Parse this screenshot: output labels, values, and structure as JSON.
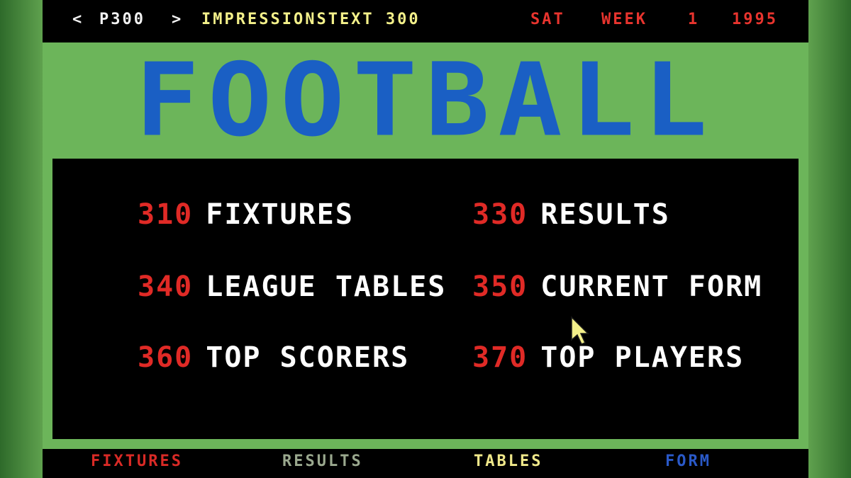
{
  "header": {
    "prev": "<",
    "page": "P300",
    "next": ">",
    "service": "IMPRESSIONSTEXT 300",
    "day": "SAT",
    "week_label": "WEEK",
    "week_number": "1",
    "year": "1995"
  },
  "title": "FOOTBALL",
  "menu": [
    {
      "number": "310",
      "label": "FIXTURES"
    },
    {
      "number": "330",
      "label": "RESULTS"
    },
    {
      "number": "340",
      "label": "LEAGUE TABLES"
    },
    {
      "number": "350",
      "label": "CURRENT FORM"
    },
    {
      "number": "360",
      "label": "TOP SCORERS"
    },
    {
      "number": "370",
      "label": "TOP PLAYERS"
    }
  ],
  "fastext": [
    {
      "label": "FIXTURES",
      "color": "#d92a26"
    },
    {
      "label": "RESULTS",
      "color": "#9aa88e"
    },
    {
      "label": "TABLES",
      "color": "#f0e88a"
    },
    {
      "label": "FORM",
      "color": "#2a59c8"
    }
  ],
  "colors": {
    "title": "#1a5fc4",
    "page_numbers": "#e02a26",
    "background_green": "#6cb55a"
  }
}
